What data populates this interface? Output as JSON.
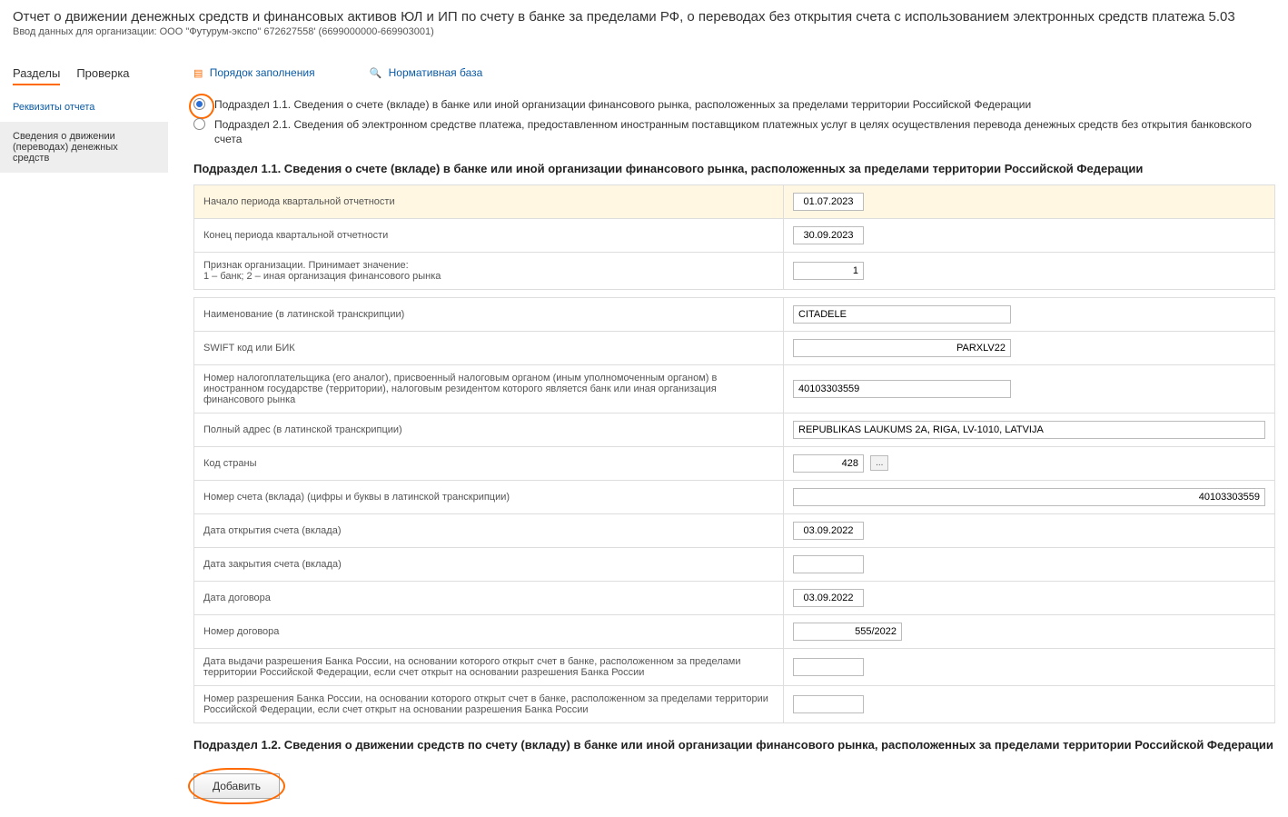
{
  "header": {
    "title": "Отчет о движении денежных средств и финансовых активов ЮЛ и ИП по счету в банке за пределами РФ, о переводах без открытия счета с использованием электронных средств платежа 5.03",
    "sub": "Ввод данных для организации: ООО \"Футурум-экспо\" 672627558' (6699000000-669903001)"
  },
  "sidebar": {
    "tab_active": "Разделы",
    "tab_inactive": "Проверка",
    "item1": "Реквизиты отчета",
    "item2": "Сведения о движении (переводах) денежных средств"
  },
  "links": {
    "order": "Порядок заполнения",
    "norm": "Нормативная база"
  },
  "radios": {
    "r1": "Подраздел 1.1. Сведения о счете (вкладе) в банке или иной организации финансового рынка, расположенных за пределами территории Российской Федерации",
    "r2": "Подраздел 2.1. Сведения об электронном средстве платежа, предоставленном иностранным поставщиком платежных услуг в целях осуществления перевода денежных средств без открытия банковского счета"
  },
  "section1_title": "Подраздел 1.1. Сведения о счете (вкладе) в банке или иной организации финансового рынка, расположенных за пределами территории Российской Федерации",
  "section2_title": "Подраздел 1.2. Сведения о движении средств по счету (вкладу) в банке или иной организации финансового рынка, расположенных за пределами территории Российской Федерации",
  "labels": {
    "period_start": "Начало периода квартальной отчетности",
    "period_end": "Конец периода квартальной отчетности",
    "org_sign": "Признак организации. Принимает значение:\n1 – банк; 2 – иная организация финансового рынка",
    "name_latin": "Наименование (в латинской транскрипции)",
    "swift": "SWIFT код или БИК",
    "tax_no": "Номер налогоплательщика (его аналог), присвоенный налоговым органом (иным уполномоченным органом) в иностранном государстве (территории), налоговым резидентом которого является банк или иная организация финансового рынка",
    "address": "Полный адрес (в латинской транскрипции)",
    "country": "Код страны",
    "acct_no": "Номер счета (вклада) (цифры и буквы в латинской транскрипции)",
    "open_date": "Дата открытия счета (вклада)",
    "close_date": "Дата закрытия счета (вклада)",
    "contract_date": "Дата договора",
    "contract_no": "Номер договора",
    "permit_date": "Дата выдачи разрешения Банка России, на основании которого открыт счет в банке, расположенном за пределами территории Российской Федерации, если счет открыт на основании разрешения Банка России",
    "permit_no": "Номер разрешения Банка России, на основании которого открыт счет в банке, расположенном за пределами территории Российской Федерации, если счет открыт на основании разрешения Банка России"
  },
  "values": {
    "period_start": "01.07.2023",
    "period_end": "30.09.2023",
    "org_sign": "1",
    "name_latin": "CITADELE",
    "swift": "PARXLV22",
    "tax_no": "40103303559",
    "address": "REPUBLIKAS LAUKUMS 2A, RIGA, LV-1010, LATVIJA",
    "country": "428",
    "acct_no": "40103303559",
    "open_date": "03.09.2022",
    "close_date": "",
    "contract_date": "03.09.2022",
    "contract_no": "555/2022",
    "permit_date": "",
    "permit_no": ""
  },
  "buttons": {
    "dots": "...",
    "add": "Добавить"
  }
}
